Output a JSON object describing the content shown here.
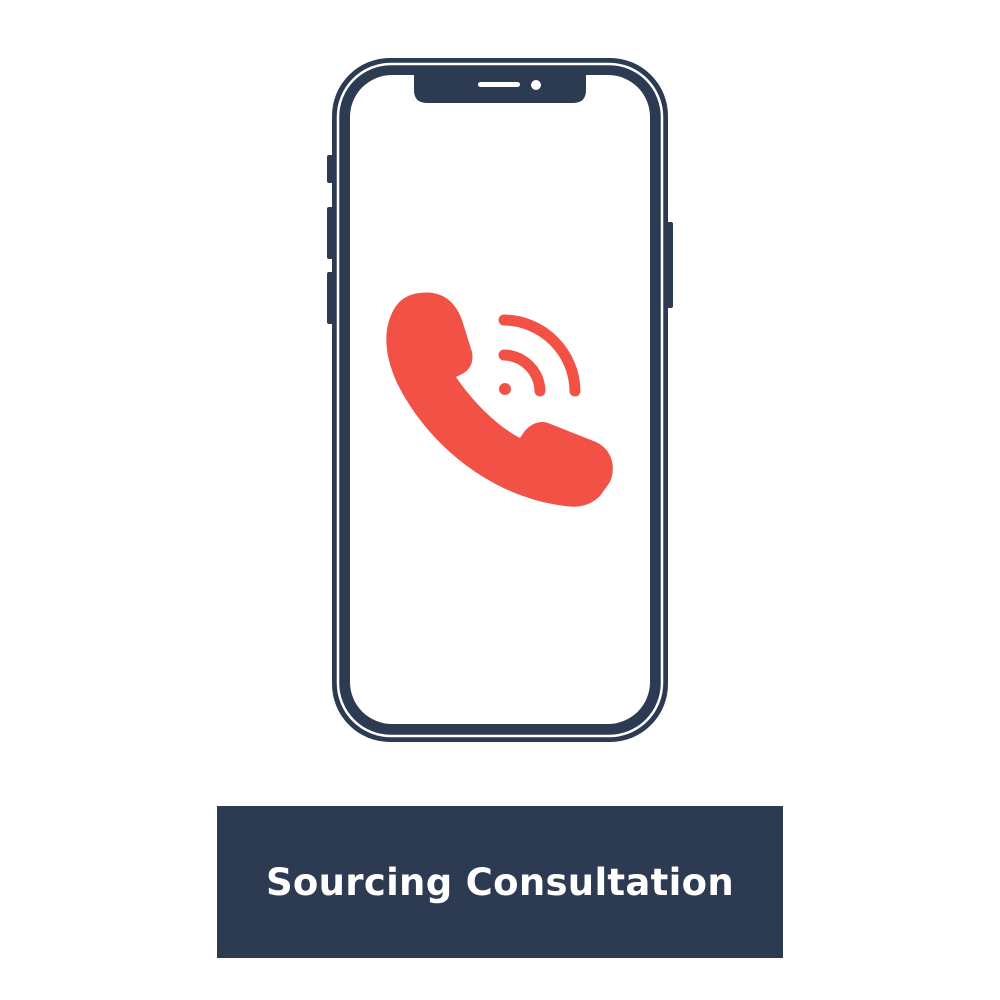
{
  "colors": {
    "navy": "#2c3a52",
    "accent": "#f25246",
    "background": "#ffffff"
  },
  "illustration": {
    "device": "smartphone",
    "screen_icon": "phone-call-icon"
  },
  "banner": {
    "label": "Sourcing Consultation"
  }
}
